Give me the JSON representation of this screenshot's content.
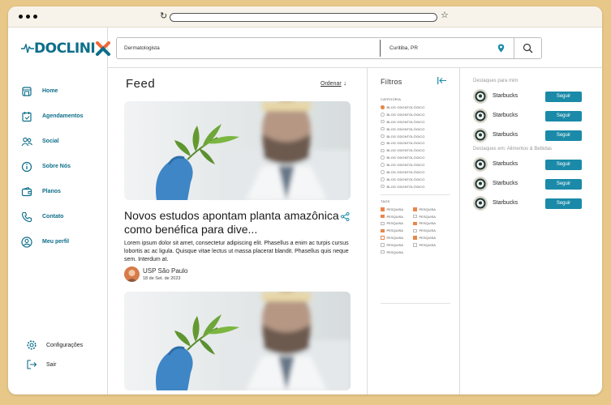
{
  "app": {
    "logo_text": "DOCLINI"
  },
  "colors": {
    "brand": "#0d6e8a",
    "accent": "#e8874b",
    "button": "#1a8aa8",
    "frame": "#e8c889"
  },
  "sidebar": {
    "items": [
      {
        "label": "Home",
        "icon": "home-icon"
      },
      {
        "label": "Agendamentos",
        "icon": "calendar-icon"
      },
      {
        "label": "Social",
        "icon": "people-icon"
      },
      {
        "label": "Sobre Nós",
        "icon": "info-icon"
      },
      {
        "label": "Planos",
        "icon": "wallet-icon"
      },
      {
        "label": "Contato",
        "icon": "phone-icon"
      },
      {
        "label": "Meu perfil",
        "icon": "user-icon"
      }
    ],
    "bottom": [
      {
        "label": "Configurações",
        "icon": "gear-icon"
      },
      {
        "label": "Sair",
        "icon": "logout-icon"
      }
    ]
  },
  "search": {
    "specialty": "Dermatologista",
    "location": "Curitiba, PR"
  },
  "feed": {
    "title": "Feed",
    "sort_label": "Ordenar",
    "post": {
      "title": "Novos estudos apontam planta amazônica como benéfica para dive...",
      "body": "Lorem ipsum dolor sit amet, consectetur adipiscing elit. Phasellus a enim ac turpis cursus lobortis ac ac ligula. Quisque vitae lectus ut massa placerat blandit. Phasellus quis neque sem. Interdum at.",
      "author": "USP São Paulo",
      "date": "18 de Set. de 2023"
    }
  },
  "filters": {
    "title": "Filtros",
    "category_label": "CATEGORIA",
    "categories": [
      {
        "label": "BLOG ODONTOLÓGICO",
        "selected": true
      },
      {
        "label": "BLOG ODONTOLÓGICO",
        "selected": false
      },
      {
        "label": "BLOG ODONTOLÓGICO",
        "selected": false
      },
      {
        "label": "BLOG ODONTOLÓGICO",
        "selected": false
      },
      {
        "label": "BLOG ODONTOLÓGICO",
        "selected": false
      },
      {
        "label": "BLOG ODONTOLÓGICO",
        "selected": false
      },
      {
        "label": "BLOG ODONTOLÓGICO",
        "selected": false
      },
      {
        "label": "BLOG ODONTOLÓGICO",
        "selected": false
      },
      {
        "label": "BLOG ODONTOLÓGICO",
        "selected": false
      },
      {
        "label": "BLOG ODONTOLÓGICO",
        "selected": false
      },
      {
        "label": "BLOG ODONTOLÓGICO",
        "selected": false
      },
      {
        "label": "BLOG ODONTOLÓGICO",
        "selected": false
      }
    ],
    "tags_label": "TAGS",
    "tags": [
      {
        "label": "PESQUISA",
        "state": "on"
      },
      {
        "label": "PESQUISA",
        "state": "on"
      },
      {
        "label": "PESQUISA",
        "state": "on"
      },
      {
        "label": "PESQUISA",
        "state": "off"
      },
      {
        "label": "PESQUISA",
        "state": "off"
      },
      {
        "label": "PESQUISA",
        "state": "on"
      },
      {
        "label": "PESQUISA",
        "state": "on"
      },
      {
        "label": "PESQUISA",
        "state": "off"
      },
      {
        "label": "PESQUISA",
        "state": "partial"
      },
      {
        "label": "PESQUISA",
        "state": "on"
      },
      {
        "label": "PESQUISA",
        "state": "off"
      },
      {
        "label": "PESQUISA",
        "state": "off"
      },
      {
        "label": "PESQUISA",
        "state": "off"
      }
    ]
  },
  "highlights": {
    "section1": "Destaques para mim",
    "section2": "Destaques em: Alimentos & Bebidas",
    "button_label": "Seguir",
    "list1": [
      {
        "name": "Starbucks"
      },
      {
        "name": "Starbucks"
      },
      {
        "name": "Starbucks"
      }
    ],
    "list2": [
      {
        "name": "Starbucks"
      },
      {
        "name": "Starbucks"
      },
      {
        "name": "Starbucks"
      }
    ]
  }
}
